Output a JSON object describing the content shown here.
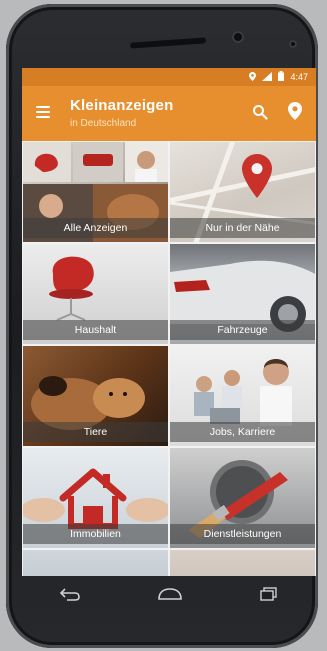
{
  "statusbar": {
    "time": "4:47",
    "icons": [
      "location-icon",
      "signal-icon",
      "battery-icon"
    ]
  },
  "appbar": {
    "title": "Kleinanzeigen",
    "subtitle": "in Deutschland",
    "icons": [
      "menu-icon",
      "search-icon",
      "location-pin-icon"
    ]
  },
  "categories": [
    {
      "label": "Alle Anzeigen"
    },
    {
      "label": "Nur in der Nähe"
    },
    {
      "label": "Haushalt"
    },
    {
      "label": "Fahrzeuge"
    },
    {
      "label": "Tiere"
    },
    {
      "label": "Jobs, Karriere"
    },
    {
      "label": "Immobilien"
    },
    {
      "label": "Dienstleistungen"
    }
  ],
  "navbar": {
    "icons": [
      "back-icon",
      "home-icon",
      "recent-apps-icon"
    ]
  },
  "colors": {
    "appbar": "#e78f2f",
    "statusbar": "#d77e25",
    "accent": "#c9312b"
  }
}
